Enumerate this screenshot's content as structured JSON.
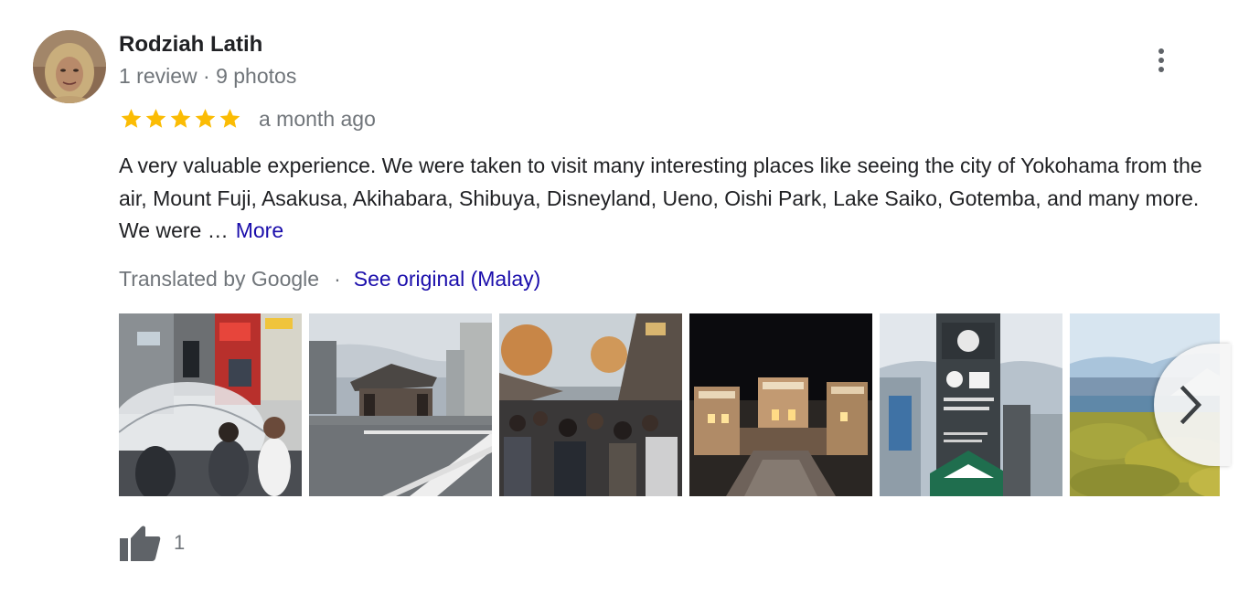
{
  "reviewer": {
    "name": "Rodziah Latih",
    "meta": "1 review · 9 photos"
  },
  "rating": {
    "stars": 5,
    "max_stars": 5,
    "star_color": "#fbbc04",
    "date": "a month ago"
  },
  "review": {
    "text": "A very valuable experience. We were taken to visit many interesting places like seeing the city of Yokohama from the air, Mount Fuji, Asakusa, Akihabara, Shibuya, Disneyland, Ueno, Oishi Park, Lake Saiko, Gotemba, and many more. We were …",
    "more_label": "More"
  },
  "translation": {
    "label": "Translated by Google",
    "separator": "·",
    "see_original_label": "See original (Malay)"
  },
  "photos": {
    "visible_count": 6,
    "next_icon": "chevron-right-icon"
  },
  "likes": {
    "icon": "thumbs-up-icon",
    "count": "1"
  },
  "colors": {
    "link": "#1a0dab",
    "secondary_text": "#70757a",
    "primary_text": "#202124",
    "star": "#fbbc04"
  },
  "icons": {
    "menu": "more-vert-icon",
    "star": "star-icon"
  }
}
